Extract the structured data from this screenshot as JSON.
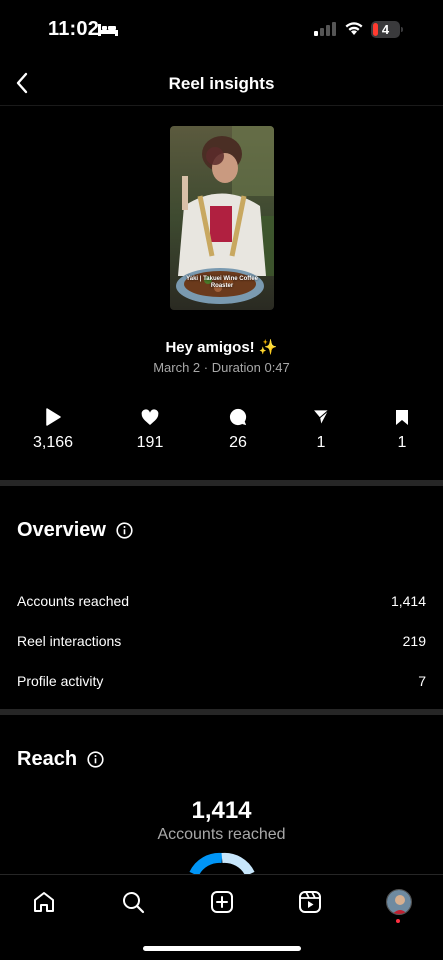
{
  "status_bar": {
    "time": "11:02",
    "battery": "4"
  },
  "header": {
    "title": "Reel insights"
  },
  "reel": {
    "thumbnail_caption": "Yaki | Takuei Wine Coffee Roaster",
    "title": "Hey amigos! ✨",
    "meta": "March 2 · Duration 0:47"
  },
  "stats": [
    {
      "icon": "play-icon",
      "value": "3,166"
    },
    {
      "icon": "heart-icon",
      "value": "191"
    },
    {
      "icon": "comment-icon",
      "value": "26"
    },
    {
      "icon": "share-icon",
      "value": "1"
    },
    {
      "icon": "bookmark-icon",
      "value": "1"
    }
  ],
  "overview": {
    "title": "Overview",
    "rows": [
      {
        "label": "Accounts reached",
        "value": "1,414"
      },
      {
        "label": "Reel interactions",
        "value": "219"
      },
      {
        "label": "Profile activity",
        "value": "7"
      }
    ]
  },
  "reach": {
    "title": "Reach",
    "value": "1,414",
    "label": "Accounts reached"
  },
  "tab_bar": {
    "tabs": [
      "home-icon",
      "search-icon",
      "create-icon",
      "reels-icon",
      "profile-avatar"
    ]
  },
  "colors": {
    "background": "#000000",
    "divider": "#262626",
    "muted_text": "#a8a8a8",
    "reach_blue": "#0095f6",
    "reach_light": "#c7e6fb",
    "notification_dot": "#ff3040"
  }
}
